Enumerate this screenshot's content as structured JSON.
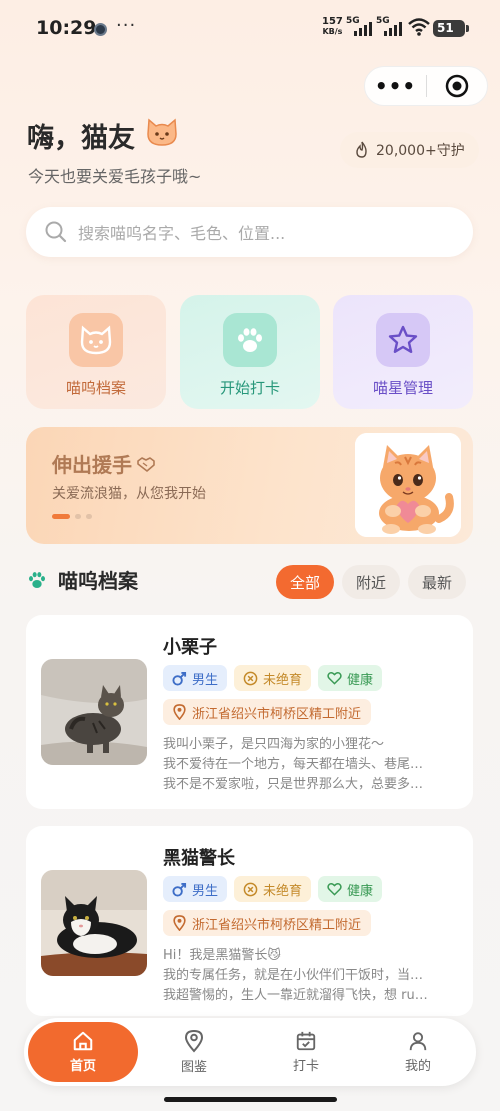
{
  "status_bar": {
    "time": "10:29",
    "more": "···",
    "net_speed_value": "157",
    "net_speed_unit": "KB/s",
    "sig1": "5G",
    "sig2": "5G",
    "battery": "51"
  },
  "header": {
    "greeting": "嗨，猫友",
    "subtitle": "今天也要关爱毛孩子哦~",
    "guard_count": "20,000+守护"
  },
  "search": {
    "placeholder": "搜索喵呜名字、毛色、位置..."
  },
  "quick_actions": [
    {
      "label": "喵呜档案",
      "icon": "cat-face-icon"
    },
    {
      "label": "开始打卡",
      "icon": "paw-icon"
    },
    {
      "label": "喵星管理",
      "icon": "star-icon"
    }
  ],
  "banner": {
    "title": "伸出援手",
    "subtitle": "关爱流浪猫，从您我开始",
    "slide_index": 1,
    "slide_count": 3
  },
  "section": {
    "title": "喵呜档案",
    "filters": [
      "全部",
      "附近",
      "最新"
    ],
    "active_filter": "全部"
  },
  "cats": [
    {
      "name": "小栗子",
      "gender": "男生",
      "sterilized": "未绝育",
      "health": "健康",
      "location": "浙江省绍兴市柯桥区精工附近",
      "desc": [
        "我叫小栗子，是只四海为家的小狸花～",
        "我不爱待在一个地方，每天都在墙头、巷尾…",
        "我不是不爱家啦，只是世界那么大，总要多…"
      ]
    },
    {
      "name": "黑猫警长",
      "gender": "男生",
      "sterilized": "未绝育",
      "health": "健康",
      "location": "浙江省绍兴市柯桥区精工附近",
      "desc": [
        "Hi！我是黑猫警长😼",
        "我的专属任务，就是在小伙伴们干饭时，当…",
        "我超警惕的，生人一靠近就溜得飞快，想 ru…"
      ]
    }
  ],
  "tabbar": {
    "items": [
      "首页",
      "图鉴",
      "打卡",
      "我的"
    ],
    "active": "首页"
  },
  "colors": {
    "accent": "#f36a30",
    "male": "#3e6ec7",
    "sterilized": "#c48a2a",
    "health": "#3a9a55",
    "location": "#c36a30"
  }
}
